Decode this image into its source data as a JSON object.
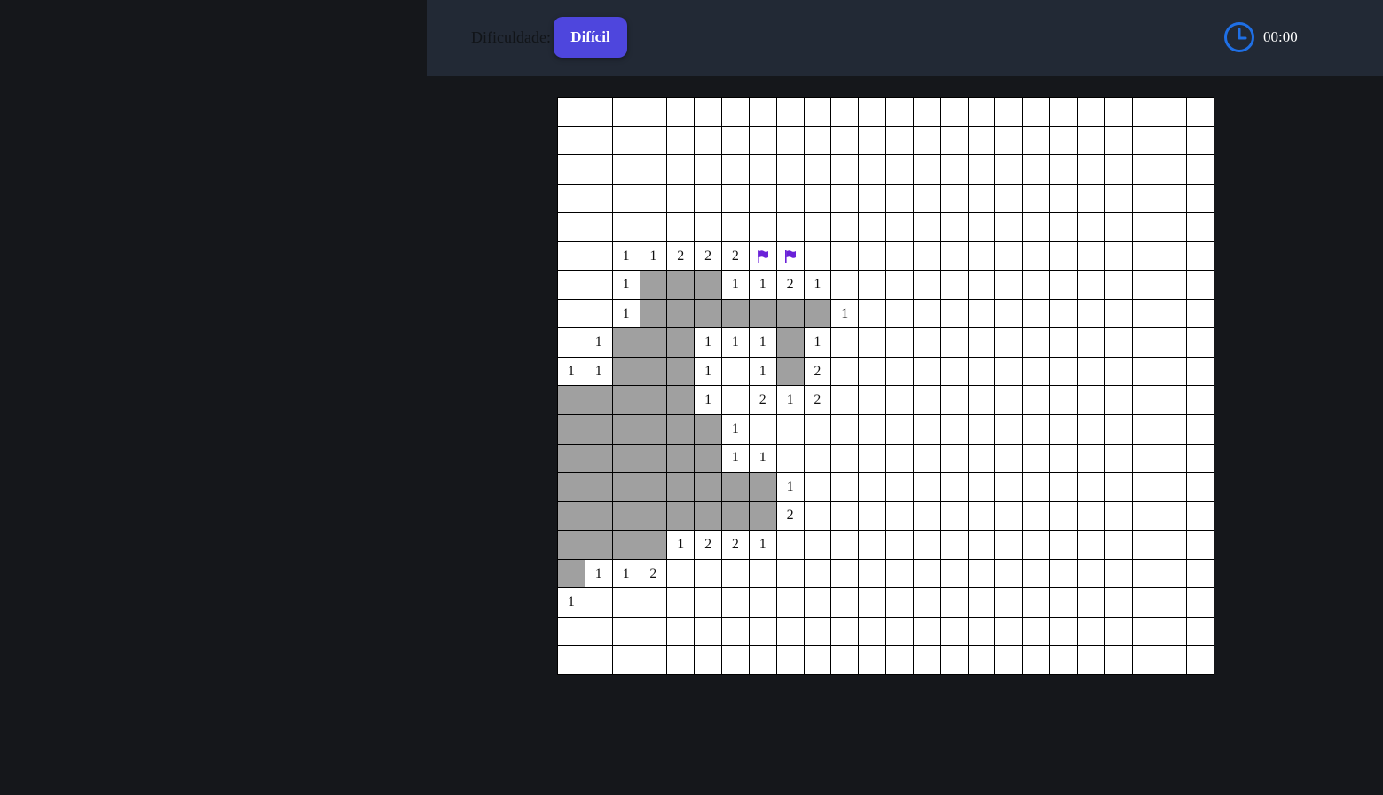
{
  "header": {
    "difficulty_label": "Dificuldade:",
    "difficulty_button": "Difícil",
    "timer": "00:00"
  },
  "colors": {
    "page_bg": "#15171b",
    "header_bg": "#222935",
    "accent": "#4e46dd",
    "clock": "#1f6fe5",
    "revealed_cell": "#a0a0a0",
    "hidden_cell": "#ffffff",
    "flag": "#6a22d8"
  },
  "board": {
    "cols": 24,
    "rows": 20,
    "legend": {
      "#": "revealed-empty",
      "F": "flag",
      ".": "hidden",
      "1-8": "number"
    },
    "grid": [
      "........................",
      "........................",
      "........................",
      "........................",
      "........................",
      "..11222FF...............",
      "..1###1121..............",
      "..1#######1.............",
      ".1###111#1..............",
      "11###1.1#2..............",
      "#####1.212..............",
      "######1.................",
      "######11................",
      "########1...............",
      "########2...............",
      "####1221................",
      "#112....................",
      "1.......................",
      "........................",
      "........................"
    ]
  }
}
